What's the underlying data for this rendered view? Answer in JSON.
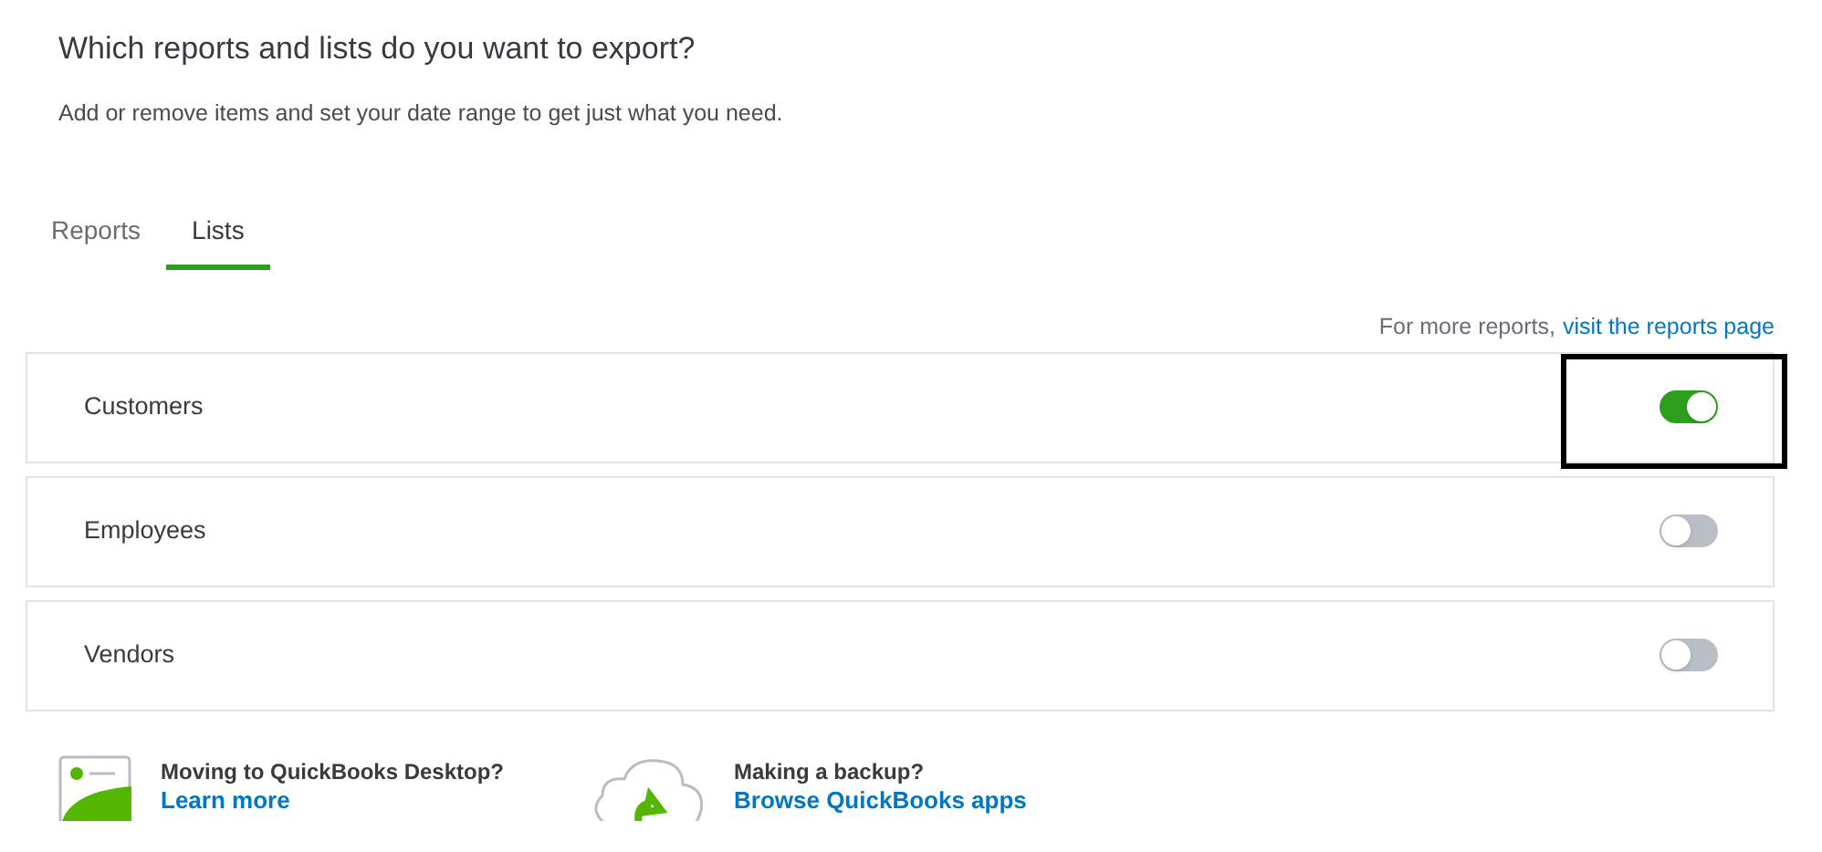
{
  "header": {
    "title": "Which reports and lists do you want to export?",
    "subtitle": "Add or remove items and set your date range to get just what you need."
  },
  "tabs": [
    {
      "label": "Reports",
      "selected": false
    },
    {
      "label": "Lists",
      "selected": true
    }
  ],
  "more_reports": {
    "text": "For more reports,",
    "link": "visit the reports page"
  },
  "lists": [
    {
      "name": "Customers",
      "on": true,
      "highlighted": true
    },
    {
      "name": "Employees",
      "on": false,
      "highlighted": false
    },
    {
      "name": "Vendors",
      "on": false,
      "highlighted": false
    }
  ],
  "footer_links": [
    {
      "kind": "desktop",
      "question": "Moving to QuickBooks Desktop?",
      "link": "Learn more"
    },
    {
      "kind": "backup",
      "question": "Making a backup?",
      "link": "Browse QuickBooks apps"
    }
  ]
}
